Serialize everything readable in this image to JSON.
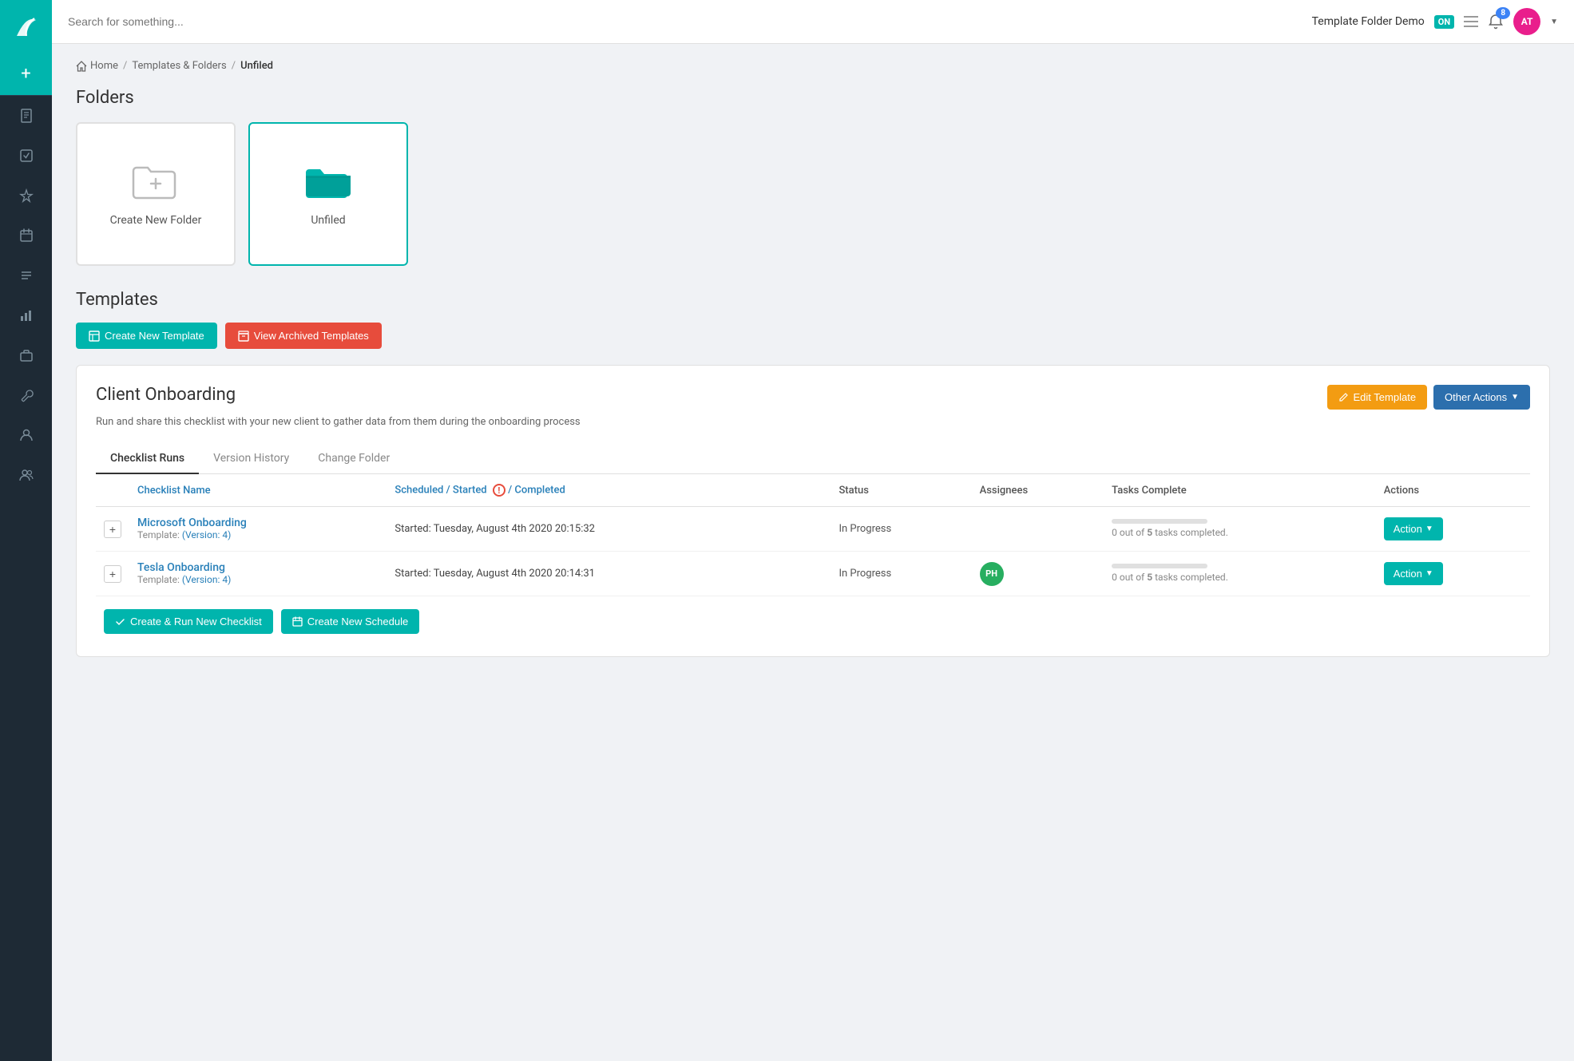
{
  "sidebar": {
    "logo_icon": "leaf",
    "items": [
      {
        "id": "add",
        "icon": "+",
        "active": true
      },
      {
        "id": "document",
        "icon": "📄"
      },
      {
        "id": "check",
        "icon": "✓"
      },
      {
        "id": "star",
        "icon": "★"
      },
      {
        "id": "calendar",
        "icon": "📅"
      },
      {
        "id": "list",
        "icon": "≡"
      },
      {
        "id": "chart",
        "icon": "📊"
      },
      {
        "id": "briefcase",
        "icon": "💼"
      },
      {
        "id": "wrench",
        "icon": "🔧"
      },
      {
        "id": "person",
        "icon": "👤"
      },
      {
        "id": "group",
        "icon": "👥"
      }
    ]
  },
  "topbar": {
    "search_placeholder": "Search for something...",
    "org_name": "Template Folder Demo",
    "badge_on": "ON",
    "badge_notif": "8",
    "avatar_initials": "AT"
  },
  "breadcrumb": {
    "home_label": "Home",
    "templates_label": "Templates & Folders",
    "current_label": "Unfiled"
  },
  "folders_section": {
    "title": "Folders",
    "cards": [
      {
        "id": "new-folder",
        "label": "Create New Folder",
        "type": "new"
      },
      {
        "id": "unfiled",
        "label": "Unfiled",
        "type": "filled",
        "selected": true
      }
    ]
  },
  "templates_section": {
    "title": "Templates",
    "btn_create": "Create New Template",
    "btn_archived": "View Archived Templates"
  },
  "template_card": {
    "title": "Client Onboarding",
    "description": "Run and share this checklist with your new client to gather data from them during the onboarding process",
    "btn_edit": "Edit Template",
    "btn_other": "Other Actions",
    "tabs": [
      "Checklist Runs",
      "Version History",
      "Change Folder"
    ],
    "active_tab": 0,
    "table": {
      "headers": [
        "",
        "Checklist Name",
        "Scheduled / Started / Completed",
        "Status",
        "Assignees",
        "Tasks Complete",
        "Actions"
      ],
      "rows": [
        {
          "id": "row-1",
          "name": "Microsoft Onboarding",
          "version": "(Version: 4)",
          "scheduled_started": "Started: Tuesday, August 4th 2020 20:15:32",
          "status": "In Progress",
          "assignees": [],
          "tasks_done": 0,
          "tasks_total": 5,
          "action_label": "Action"
        },
        {
          "id": "row-2",
          "name": "Tesla Onboarding",
          "version": "(Version: 4)",
          "scheduled_started": "Started: Tuesday, August 4th 2020 20:14:31",
          "status": "In Progress",
          "assignees": [
            {
              "initials": "PH",
              "color": "#27ae60"
            }
          ],
          "tasks_done": 0,
          "tasks_total": 5,
          "action_label": "Action"
        }
      ],
      "tasks_text_prefix": "0 out of",
      "tasks_text_suffix": "tasks completed."
    },
    "btn_create_run": "Create & Run New Checklist",
    "btn_schedule": "Create New Schedule"
  }
}
